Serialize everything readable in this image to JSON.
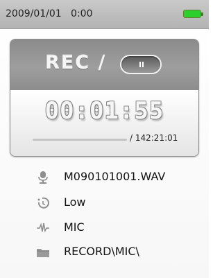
{
  "status_bar": {
    "datetime": "2009/01/01   0:00",
    "battery_level": 1.0,
    "battery_color": "#2ccf2c"
  },
  "recorder": {
    "state_label": "REC /",
    "button_icon": "pause-icon",
    "elapsed_time": "00:01:55",
    "total_time": "/ 142:21:01",
    "progress_fraction": 0.0
  },
  "info": {
    "filename": "M090101001.WAV",
    "quality": "Low",
    "source": "MIC",
    "folder": "RECORD\\MIC\\"
  },
  "icons": {
    "filename": "microphone-icon",
    "quality": "quality-icon",
    "source": "waveform-icon",
    "folder": "folder-icon"
  }
}
